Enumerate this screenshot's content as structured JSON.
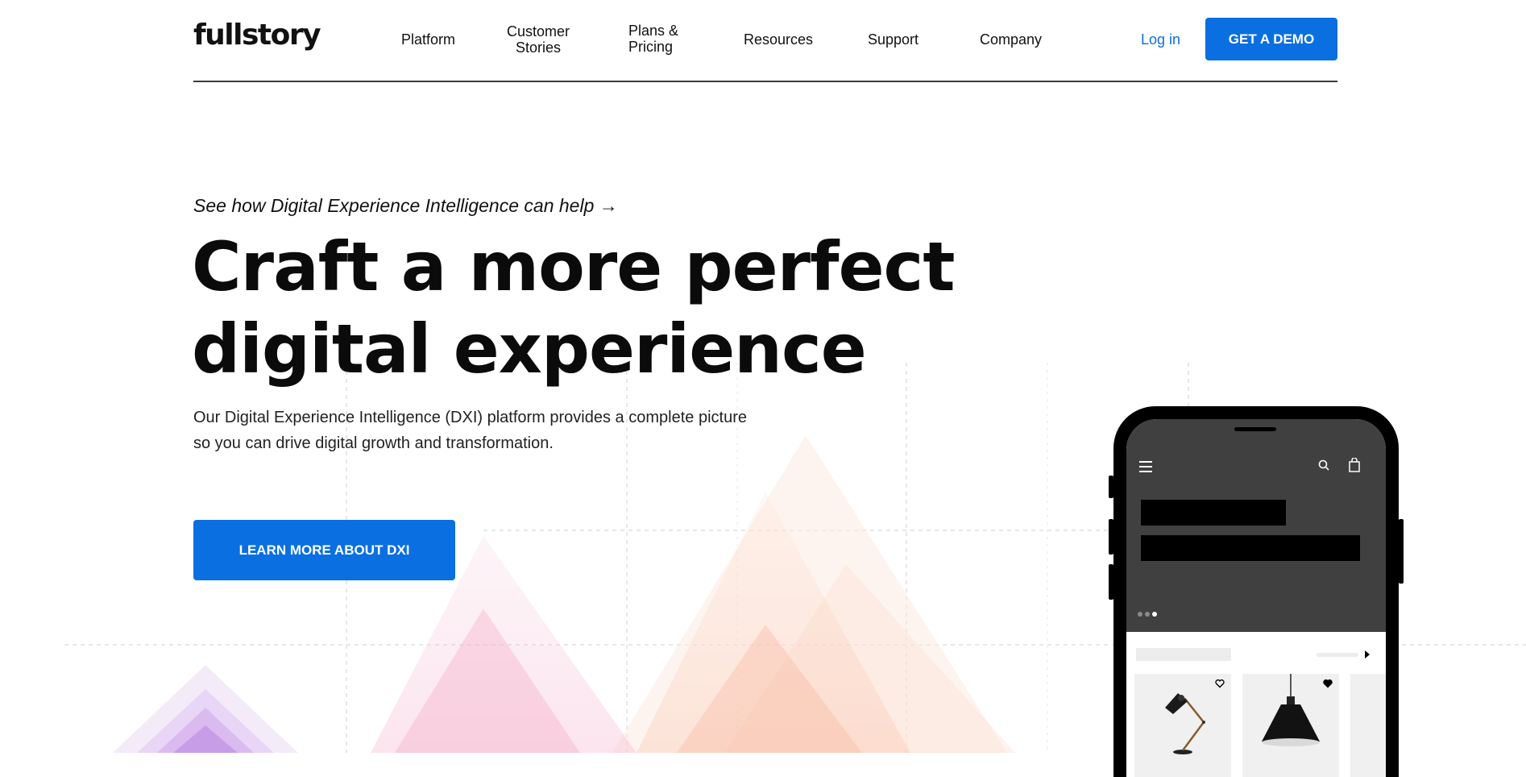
{
  "brand": {
    "logo_text": "fullstory"
  },
  "nav": {
    "items": [
      {
        "label": "Platform"
      },
      {
        "label": "Customer\nStories"
      },
      {
        "label": "Plans &\nPricing"
      },
      {
        "label": "Resources"
      },
      {
        "label": "Support"
      },
      {
        "label": "Company"
      }
    ],
    "login_label": "Log in",
    "demo_label": "GET A DEMO"
  },
  "hero": {
    "eyebrow": "See how Digital Experience Intelligence can help →",
    "headline_line1": "Craft a more perfect",
    "headline_line2": "digital experience",
    "subtext_line1": "Our Digital Experience Intelligence (DXI) platform provides a complete picture",
    "subtext_line2": "so you can drive digital growth and transformation.",
    "cta_label": "LEARN MORE ABOUT DXI"
  },
  "phone_mockup": {
    "carousel_dots": 3,
    "active_dot": 3,
    "icons": [
      "hamburger-menu-icon",
      "search-icon",
      "shopping-bag-icon",
      "arrow-right-icon",
      "heart-icon"
    ],
    "products": [
      "desk-lamp",
      "pendant-lamp"
    ]
  },
  "colors": {
    "accent": "#0a6fe0",
    "text": "#0b0b0b",
    "phone_screen": "#404040"
  }
}
